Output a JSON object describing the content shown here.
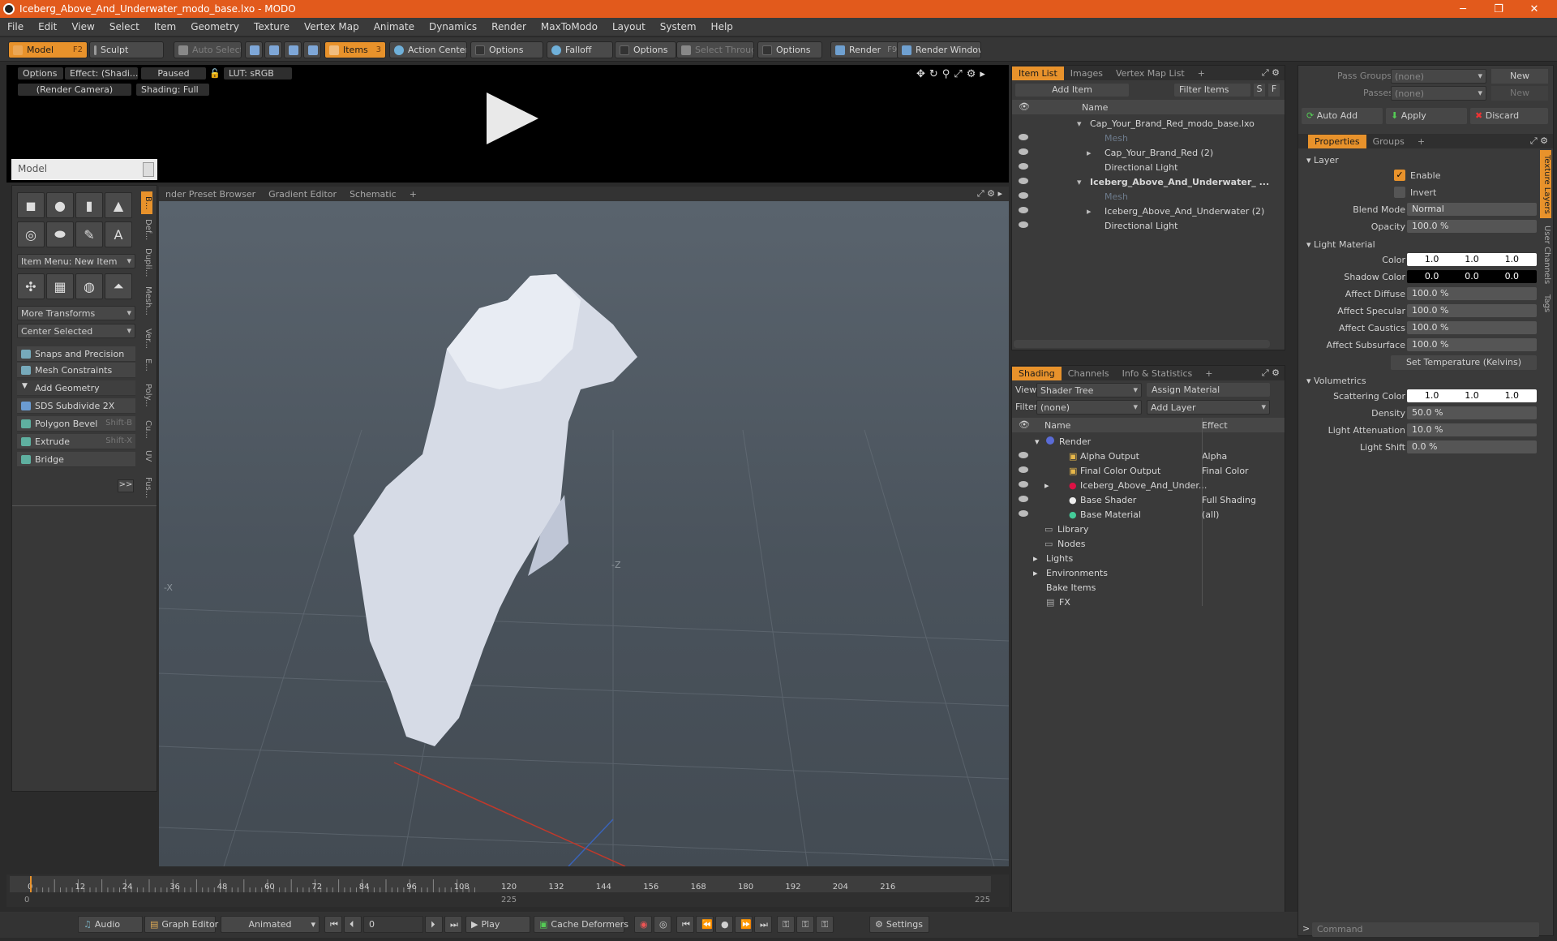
{
  "window": {
    "title": "Iceberg_Above_And_Underwater_modo_base.lxo - MODO"
  },
  "menu": [
    "File",
    "Edit",
    "View",
    "Select",
    "Item",
    "Geometry",
    "Texture",
    "Vertex Map",
    "Animate",
    "Dynamics",
    "Render",
    "MaxToModo",
    "Layout",
    "System",
    "Help"
  ],
  "toolbar": {
    "model": "Model",
    "model_key": "F2",
    "sculpt": "Sculpt",
    "auto_select": "Auto Select",
    "items": "Items",
    "items_key": "3",
    "action_center": "Action Center",
    "options1": "Options",
    "falloff": "Falloff",
    "options2": "Options",
    "select_through": "Select Through",
    "options3": "Options",
    "render": "Render",
    "render_key": "F9",
    "render_window": "Render Window"
  },
  "viewport_top": {
    "options": "Options",
    "effect": "Effect: (Shadi...",
    "paused": "Paused",
    "lut": "LUT: sRGB",
    "camera": "(Render Camera)",
    "shading": "Shading: Full"
  },
  "viewport3d": {
    "tabs": [
      "nder Preset Browser",
      "Gradient Editor",
      "Schematic",
      "+"
    ],
    "axis_x": "-X",
    "axis_z": "-Z"
  },
  "toolbox": {
    "title": "Model",
    "item_menu": "Item Menu: New Item",
    "more_transforms": "More Transforms",
    "center_selected": "Center Selected",
    "rows": [
      {
        "label": "Snaps and Precision",
        "key": ""
      },
      {
        "label": "Mesh Constraints",
        "key": ""
      },
      {
        "label": "Add Geometry",
        "key": ""
      },
      {
        "label": "SDS Subdivide 2X",
        "key": ""
      },
      {
        "label": "Polygon Bevel",
        "key": "Shift-B"
      },
      {
        "label": "Extrude",
        "key": "Shift-X"
      },
      {
        "label": "Bridge",
        "key": ""
      }
    ],
    "more": ">>",
    "vtabs": [
      "B...",
      "Def...",
      "Dupli...",
      "Mesh...",
      "Ver...",
      "E...",
      "Poly...",
      "Cu...",
      "UV",
      "Fus..."
    ]
  },
  "itemlist": {
    "tabs": [
      "Item List",
      "Images",
      "Vertex Map List",
      "+"
    ],
    "add_item": "Add Item",
    "filter_items": "Filter Items",
    "s": "S",
    "f": "F",
    "col_name": "Name",
    "rows": [
      {
        "label": "Cap_Your_Brand_Red_modo_base.lxo",
        "bold": false,
        "indent": 0,
        "dim": false
      },
      {
        "label": "Mesh",
        "bold": false,
        "indent": 1,
        "dim": true
      },
      {
        "label": "Cap_Your_Brand_Red (2)",
        "bold": false,
        "indent": 1,
        "dim": false
      },
      {
        "label": "Directional Light",
        "bold": false,
        "indent": 1,
        "dim": false
      },
      {
        "label": "Iceberg_Above_And_Underwater_ ...",
        "bold": true,
        "indent": 0,
        "dim": false
      },
      {
        "label": "Mesh",
        "bold": false,
        "indent": 1,
        "dim": true
      },
      {
        "label": "Iceberg_Above_And_Underwater (2)",
        "bold": false,
        "indent": 1,
        "dim": false
      },
      {
        "label": "Directional Light",
        "bold": false,
        "indent": 1,
        "dim": false
      }
    ]
  },
  "shading": {
    "tabs": [
      "Shading",
      "Channels",
      "Info & Statistics",
      "+"
    ],
    "view_label": "View",
    "view_value": "Shader Tree",
    "assign": "Assign Material",
    "filter_label": "Filter",
    "filter_value": "(none)",
    "add_layer": "Add Layer",
    "col_name": "Name",
    "col_effect": "Effect",
    "rows": [
      {
        "label": "Render",
        "effect": ""
      },
      {
        "label": "Alpha Output",
        "effect": "Alpha"
      },
      {
        "label": "Final Color Output",
        "effect": "Final Color"
      },
      {
        "label": "Iceberg_Above_And_Under...",
        "effect": ""
      },
      {
        "label": "Base Shader",
        "effect": "Full Shading"
      },
      {
        "label": "Base Material",
        "effect": "(all)"
      },
      {
        "label": "Library",
        "effect": ""
      },
      {
        "label": "Nodes",
        "effect": ""
      },
      {
        "label": "Lights",
        "effect": ""
      },
      {
        "label": "Environments",
        "effect": ""
      },
      {
        "label": "Bake Items",
        "effect": ""
      },
      {
        "label": "FX",
        "effect": ""
      }
    ]
  },
  "properties": {
    "pass_groups": "Pass Groups",
    "passes": "Passes",
    "none": "(none)",
    "new": "New",
    "auto_add": "Auto Add",
    "apply": "Apply",
    "discard": "Discard",
    "tabs": [
      "Properties",
      "Groups",
      "+"
    ],
    "side_tabs": [
      "Texture Layers",
      "User Channels",
      "Tags"
    ],
    "layer": "Layer",
    "enable": "Enable",
    "invert": "Invert",
    "blend_mode_label": "Blend Mode",
    "blend_mode": "Normal",
    "opacity_label": "Opacity",
    "opacity": "100.0 %",
    "light_material": "Light Material",
    "color_label": "Color",
    "color": [
      "1.0",
      "1.0",
      "1.0"
    ],
    "shadow_label": "Shadow Color",
    "shadow": [
      "0.0",
      "0.0",
      "0.0"
    ],
    "affect_diffuse_label": "Affect Diffuse",
    "affect_diffuse": "100.0 %",
    "affect_specular_label": "Affect Specular",
    "affect_specular": "100.0 %",
    "affect_caustics_label": "Affect Caustics",
    "affect_caustics": "100.0 %",
    "affect_subsurface_label": "Affect Subsurface",
    "affect_subsurface": "100.0 %",
    "set_temp": "Set Temperature (Kelvins)",
    "volumetrics": "Volumetrics",
    "scatter_label": "Scattering Color",
    "scatter": [
      "1.0",
      "1.0",
      "1.0"
    ],
    "density_label": "Density",
    "density": "50.0 %",
    "atten_label": "Light Attenuation",
    "atten": "10.0 %",
    "shift_label": "Light Shift",
    "shift": "0.0 %"
  },
  "timeline": {
    "ticks": [
      "0",
      "12",
      "24",
      "36",
      "48",
      "60",
      "72",
      "84",
      "96",
      "108",
      "120",
      "132",
      "144",
      "156",
      "168",
      "180",
      "192",
      "204",
      "216"
    ],
    "start": "0",
    "mid": "225",
    "end": "225"
  },
  "bottom": {
    "audio": "Audio",
    "graph_editor": "Graph Editor",
    "animated": "Animated",
    "frame": "0",
    "play": "Play",
    "cache": "Cache Deformers",
    "settings": "Settings",
    "command": "Command"
  }
}
